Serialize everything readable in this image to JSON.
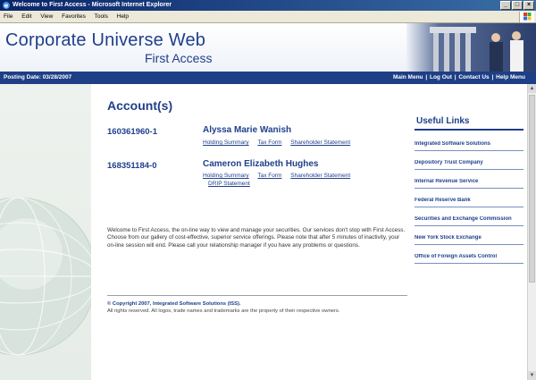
{
  "window": {
    "title": "Welcome to First Access - Microsoft Internet Explorer"
  },
  "menu": [
    "File",
    "Edit",
    "View",
    "Favorites",
    "Tools",
    "Help"
  ],
  "header": {
    "brand": "Corporate Universe Web",
    "subtitle": "First Access"
  },
  "navbar": {
    "posting_date": "Posting Date: 03/28/2007",
    "links": [
      "Main Menu",
      "Log Out",
      "Contact Us",
      "Help Menu"
    ],
    "separator": "|"
  },
  "main": {
    "title": "Account(s)",
    "accounts": [
      {
        "number": "160361960-1",
        "owner": "Alyssa Marie Wanish",
        "links": [
          "Holding Summary",
          "Tax Form",
          "Shareholder Statement"
        ]
      },
      {
        "number": "168351184-0",
        "owner": "Cameron Elizabeth Hughes",
        "links": [
          "Holding Summary",
          "Tax Form",
          "Shareholder Statement",
          "DRIP Statement"
        ]
      }
    ],
    "welcome": "Welcome to First Access, the on-line way to view and manage your securities. Our services don't stop with First Access. Choose from our gallery of cost-effective, superior service offerings. Please note that after 5 minutes of inactivity, your on-line session will end. Please call your relationship manager if you have any problems or questions.",
    "copyright": "© Copyright 2007, Integrated Software Solutions (ISS).",
    "rights": "All rights reserved. All logos, trade names and trademarks are the property of their respective owners."
  },
  "useful_links": {
    "title": "Useful Links",
    "items": [
      "Integrated Software Solutions",
      "Depository Trust Company",
      "Internal Revenue Service",
      "Federal Reserve Bank",
      "Securities and Exchange Commission",
      "New York Stock Exchange",
      "Office of Foreign Assets Control"
    ]
  },
  "colors": {
    "brand_blue": "#1f3f8c",
    "nav_blue": "#1e3f85"
  }
}
